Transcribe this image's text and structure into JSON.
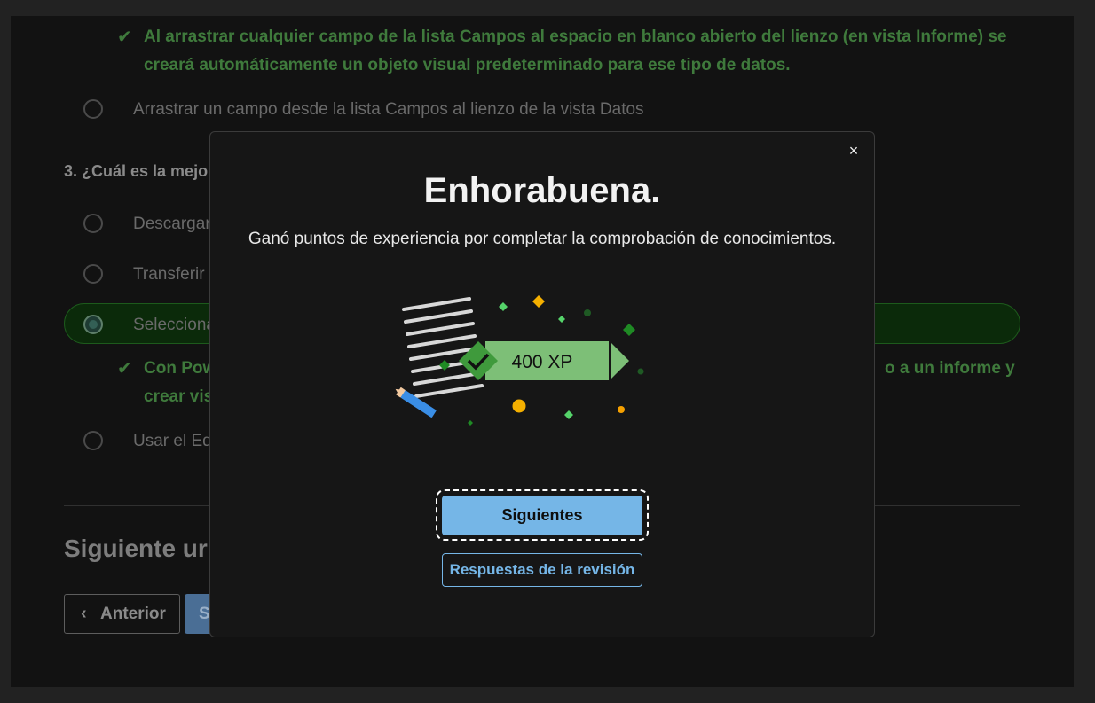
{
  "background": {
    "feedback_1": {
      "line1": "Al arrastrar cualquier campo de la lista Campos al espacio en blanco abierto del lienzo (en vista Informe) se",
      "line2": "creará automáticamente un objeto visual predeterminado para ese tipo de datos."
    },
    "option_drag_data_view": "Arrastrar un campo desde la lista Campos al lienzo de la vista Datos",
    "question_3_title": "3. ¿Cuál es la mejo",
    "q3_options": [
      {
        "label": "Descargar",
        "selected": false
      },
      {
        "label": "Transferir",
        "selected": false
      },
      {
        "label": "Selecciona",
        "selected": true
      },
      {
        "label": "Usar el Ed",
        "selected": false
      }
    ],
    "feedback_2": {
      "line1_left": "Con Pow",
      "line1_right": "o a un informe y",
      "line2": "crear vis"
    },
    "next_unit_heading": "Siguiente ur",
    "prev_button": "Anterior",
    "next_button_partial": "S"
  },
  "modal": {
    "close_symbol": "×",
    "title": "Enhorabuena.",
    "subtitle": "Ganó puntos de experiencia por completar la comprobación de conocimientos.",
    "xp_badge": "400 XP",
    "primary_button": "Siguientes",
    "secondary_button": "Respuestas de la revisión"
  },
  "colors": {
    "accent_blue": "#75b6e7",
    "success_green": "#3f7a3c",
    "badge_green": "#7dbf77",
    "confetti_gold": "#f5b000"
  }
}
